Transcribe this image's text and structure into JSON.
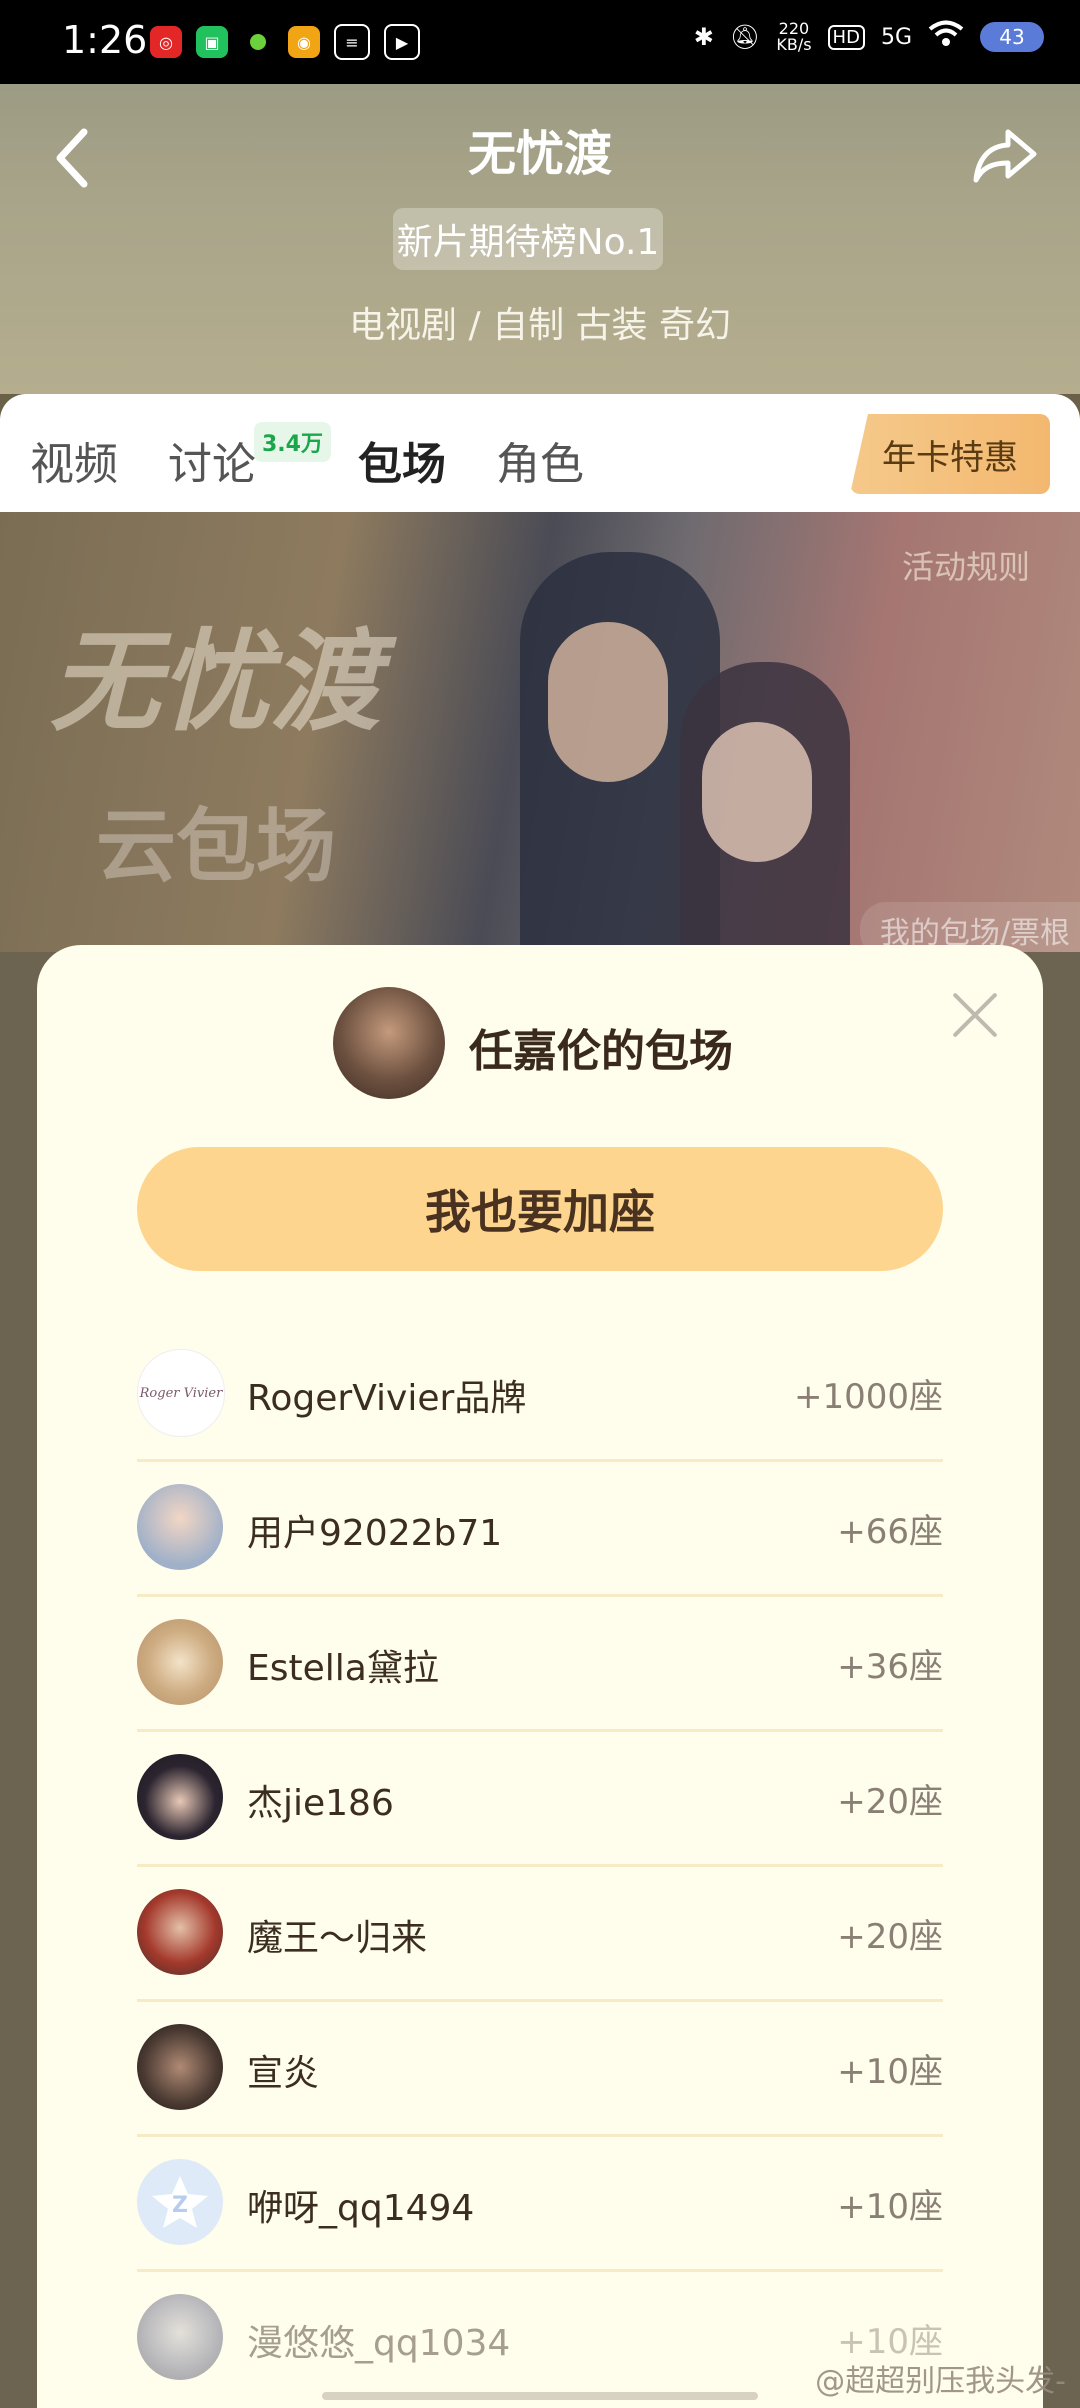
{
  "status_bar": {
    "time": "1:26",
    "net_speed": "220",
    "net_unit": "KB/s",
    "hd": "HD",
    "signal": "5G",
    "battery": "43"
  },
  "header": {
    "title": "无忧渡",
    "rank_badge": "新片期待榜No.1",
    "genre": "电视剧 / 自制 古装 奇幻"
  },
  "tabs": {
    "items": [
      "视频",
      "讨论",
      "包场",
      "角色"
    ],
    "discussion_badge": "3.4万",
    "active": "包场",
    "promo": "年卡特惠"
  },
  "banner": {
    "logo_line1": "无忧渡",
    "logo_line2": "云包场",
    "rules_link": "活动规则",
    "my_ticket": "我的包场/票根"
  },
  "modal": {
    "title": "任嘉伦的包场",
    "join_button": "我也要加座",
    "rows": [
      {
        "name": "RogerVivier品牌",
        "seats": "+1000座",
        "avatar_text": "Roger Vivier"
      },
      {
        "name": "用户92022b71",
        "seats": "+66座"
      },
      {
        "name": "Estella黛拉",
        "seats": "+36座"
      },
      {
        "name": "杰jie186",
        "seats": "+20座"
      },
      {
        "name": "魔王～归来",
        "seats": "+20座"
      },
      {
        "name": "宣炎",
        "seats": "+10座"
      },
      {
        "name": "咿呀_qq1494",
        "seats": "+10座"
      },
      {
        "name": "漫悠悠_qq1034",
        "seats": "+10座"
      }
    ]
  },
  "watermark": "@超超别压我头发-",
  "colors": {
    "accent_button": "#fed58e",
    "modal_bg": "#fffdec",
    "badge_green": "#1aa64a"
  }
}
